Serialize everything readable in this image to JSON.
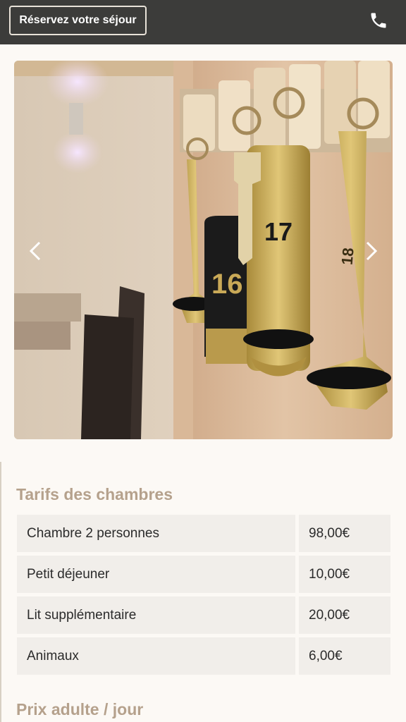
{
  "header": {
    "book_label": "Réservez votre séjour",
    "phone_icon": "phone-icon"
  },
  "carousel": {
    "prev_icon": "chevron-left-icon",
    "next_icon": "chevron-right-icon",
    "image_subject": "keys-photo",
    "key_numbers": [
      "16",
      "17",
      "18"
    ]
  },
  "rates": {
    "title": "Tarifs des chambres",
    "items": [
      {
        "label": "Chambre 2 personnes",
        "price": "98,00€"
      },
      {
        "label": "Petit déjeuner",
        "price": "10,00€"
      },
      {
        "label": "Lit supplémentaire",
        "price": "20,00€"
      },
      {
        "label": "Animaux",
        "price": "6,00€"
      }
    ]
  },
  "adult_price": {
    "title": "Prix adulte / jour"
  },
  "colors": {
    "header_bg": "#3c3c3a",
    "accent_title": "#b5a18c",
    "row_bg": "#f1eeea",
    "page_bg": "#fcf9f5"
  }
}
